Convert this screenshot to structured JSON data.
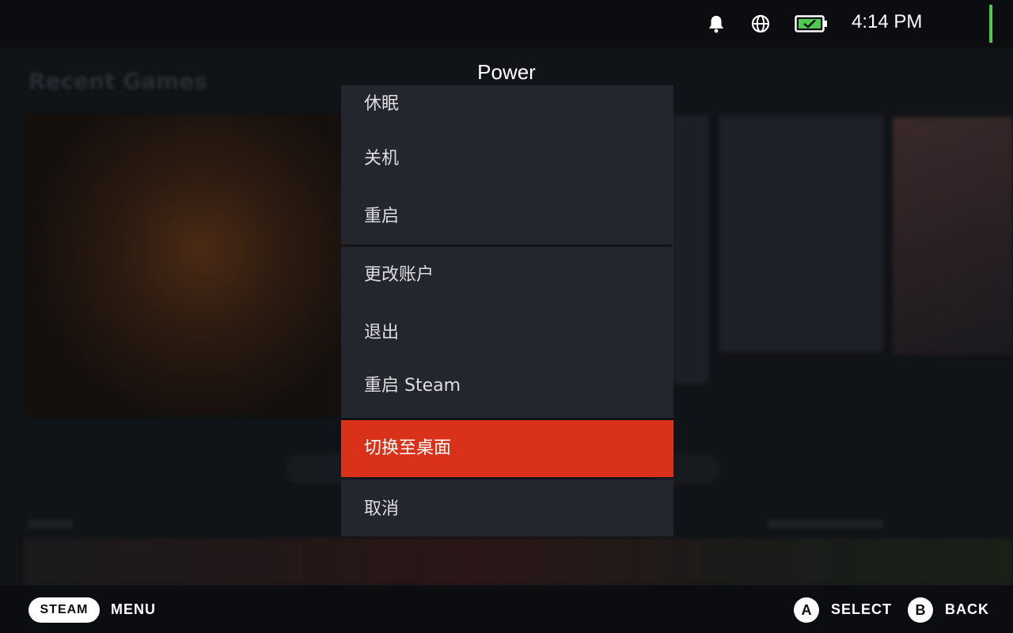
{
  "status_bar": {
    "time": "4:14 PM",
    "icons": [
      "bell-icon",
      "globe-icon",
      "battery-charging-icon"
    ],
    "battery_color": "#4ec94e"
  },
  "background": {
    "section_title": "Recent Games"
  },
  "power_menu": {
    "title": "Power",
    "groups": [
      [
        {
          "label": "休眠"
        },
        {
          "label": "关机"
        },
        {
          "label": "重启"
        }
      ],
      [
        {
          "label": "更改账户"
        },
        {
          "label": "退出"
        },
        {
          "label": "重启 Steam"
        }
      ],
      [
        {
          "label": "切换至桌面",
          "selected": true
        }
      ],
      [
        {
          "label": "取消"
        }
      ]
    ],
    "selected_color": "#d9311a"
  },
  "bottom_bar": {
    "steam_label": "STEAM",
    "menu_label": "MENU",
    "a_glyph": "A",
    "select_label": "SELECT",
    "b_glyph": "B",
    "back_label": "BACK"
  }
}
